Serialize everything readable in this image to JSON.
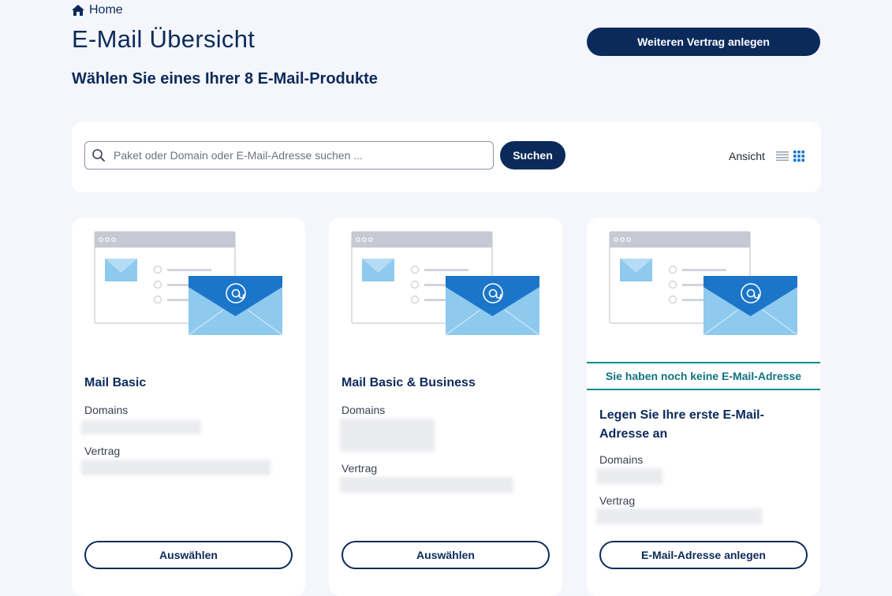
{
  "breadcrumb": {
    "home_label": "Home"
  },
  "page": {
    "title": "E-Mail Übersicht",
    "subtitle": "Wählen Sie eines Ihrer 8 E-Mail-Produkte",
    "new_contract_button": "Weiteren Vertrag anlegen"
  },
  "search": {
    "placeholder": "Paket oder Domain oder E-Mail-Adresse suchen ...",
    "value": "",
    "button_label": "Suchen",
    "view_label": "Ansicht",
    "active_view": "grid"
  },
  "cards": [
    {
      "title": "Mail Basic",
      "domains_label": "Domains",
      "contract_label": "Vertrag",
      "action_label": "Auswählen"
    },
    {
      "title": "Mail Basic & Business",
      "domains_label": "Domains",
      "contract_label": "Vertrag",
      "action_label": "Auswählen"
    },
    {
      "notice": "Sie haben noch keine E-Mail-Adresse",
      "title": "Legen Sie Ihre erste E-Mail-Adresse an",
      "domains_label": "Domains",
      "contract_label": "Vertrag",
      "action_label": "E-Mail-Adresse anlegen"
    }
  ],
  "colors": {
    "brand_navy": "#0b2a5b",
    "notice_teal": "#0f8a8a",
    "page_bg": "#f4f6fb",
    "envelope_blue": "#1b75c9",
    "envelope_light": "#8ec9ee"
  },
  "icons": [
    "home-icon",
    "search-icon",
    "list-view-icon",
    "grid-view-icon",
    "envelope-icon",
    "at-sign-icon"
  ]
}
